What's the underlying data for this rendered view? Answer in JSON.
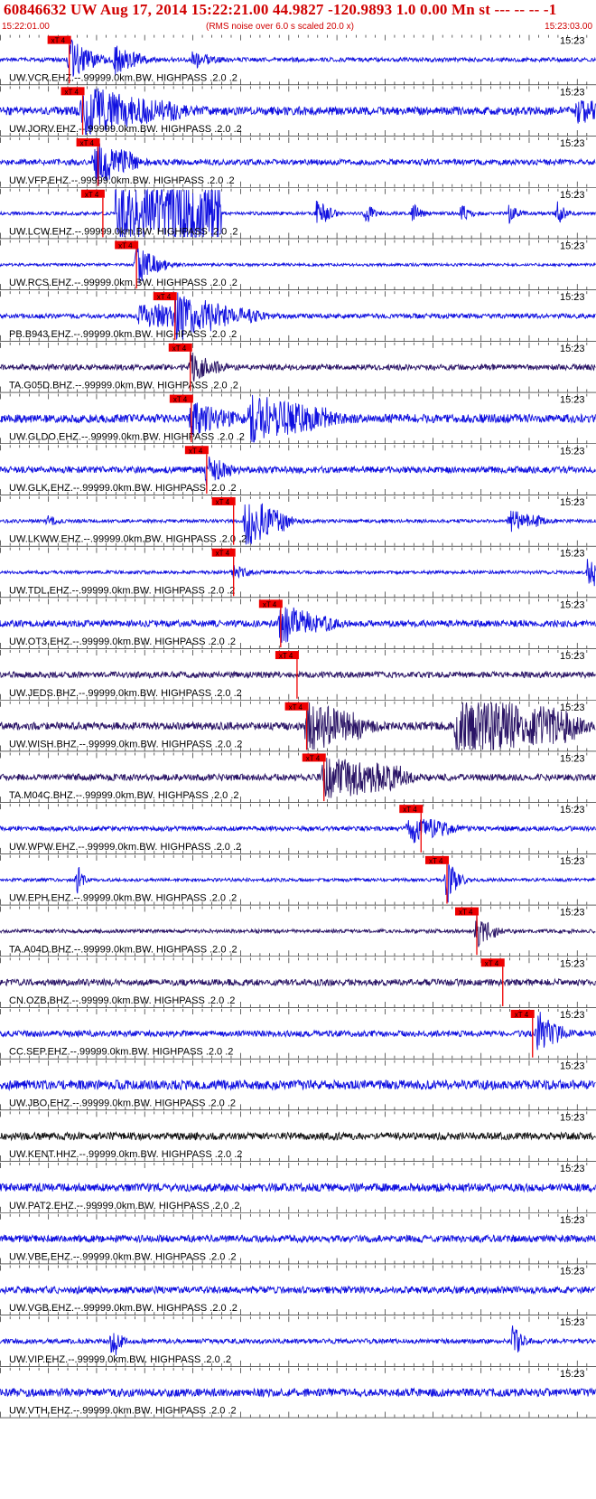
{
  "header": {
    "title": "60846632 UW Aug 17, 2014 15:22:21.00   44.9827 -120.9893  1.0 0.00 Mn st --- -- --  -1",
    "start_time": "15:22:01.00",
    "subtitle": "(RMS noise over 6.0 s scaled 20.0 x)",
    "end_time": "15:23:03.00",
    "tick_time_label": "15:23"
  },
  "colors": {
    "accent": "#d00000",
    "pick_box": "#ee0000",
    "trace_blue": "#1010e0",
    "trace_navy": "#2a1466",
    "trace_black": "#111111",
    "grid": "#000000"
  },
  "chart_data": {
    "type": "seismogram",
    "time_start": "15:22:01.00",
    "time_end": "15:23:03.00",
    "pick_label": "xT 4",
    "filter": "HIGHPASS",
    "traces": [
      {
        "label": "UW.VCR.EHZ.--.99999.0km.BW. HIGHPASS .2.0 .2",
        "pick_s": 7.2,
        "color": "blue",
        "noise": 0.09,
        "events": [
          {
            "t": 7.2,
            "amp": 0.9,
            "dur": 3.0,
            "decay": 0.5
          },
          {
            "t": 12,
            "amp": 0.6,
            "dur": 3,
            "decay": 0.5
          },
          {
            "t": 20,
            "amp": 0.4,
            "dur": 2,
            "decay": 0.4
          }
        ]
      },
      {
        "label": "UW.JORV.EHZ.--.99999.0km.BW. HIGHPASS .2.0 .2",
        "pick_s": 8.6,
        "color": "blue",
        "noise": 0.18,
        "events": [
          {
            "t": 8.6,
            "amp": 1.0,
            "dur": 10,
            "decay": 0.5
          },
          {
            "t": 60,
            "amp": 0.4,
            "dur": 4,
            "decay": 0.3
          }
        ]
      },
      {
        "label": "UW.VFP.EHZ.--.99999.0km.BW. HIGHPASS .2.0 .2",
        "pick_s": 10.2,
        "color": "blue",
        "noise": 0.12,
        "events": [
          {
            "t": 9.8,
            "amp": 1.0,
            "dur": 4,
            "decay": 0.4
          }
        ]
      },
      {
        "label": "UW.LCW.EHZ.--.99999.0km.BW. HIGHPASS .2.0 .2",
        "pick_s": 10.7,
        "color": "blue",
        "noise": 0.07,
        "events": [
          {
            "t": 12,
            "amp": 1.2,
            "dur": 11,
            "decay": 0.0,
            "shape": "box"
          },
          {
            "t": 33,
            "amp": 0.8,
            "dur": 1.5,
            "decay": 0.5
          },
          {
            "t": 38,
            "amp": 0.5,
            "dur": 1,
            "decay": 0.5
          },
          {
            "t": 43,
            "amp": 0.4,
            "dur": 1,
            "decay": 0.5
          },
          {
            "t": 48,
            "amp": 0.4,
            "dur": 1,
            "decay": 0.5
          },
          {
            "t": 53,
            "amp": 0.4,
            "dur": 1,
            "decay": 0.5
          },
          {
            "t": 58,
            "amp": 0.5,
            "dur": 1,
            "decay": 0.5
          }
        ]
      },
      {
        "label": "UW.RCS.EHZ.--.99999.0km.BW. HIGHPASS .2.0 .2",
        "pick_s": 14.2,
        "color": "blue",
        "noise": 0.06,
        "events": [
          {
            "t": 14.2,
            "amp": 0.9,
            "dur": 3,
            "decay": 0.5
          }
        ]
      },
      {
        "label": "PB.B943.EHZ.--.99999.0km.BW. HIGHPASS .2.0 .2",
        "pick_s": 18.2,
        "color": "blue",
        "noise": 0.1,
        "events": [
          {
            "t": 14.5,
            "amp": 0.5,
            "dur": 12,
            "decay": 0.3
          },
          {
            "t": 18.2,
            "amp": 0.8,
            "dur": 5,
            "decay": 0.5
          }
        ]
      },
      {
        "label": "TA.G05D.BHZ.--.99999.0km.BW. HIGHPASS .2.0 .2",
        "pick_s": 19.8,
        "color": "navy",
        "noise": 0.12,
        "events": [
          {
            "t": 19.8,
            "amp": 0.6,
            "dur": 3,
            "decay": 0.5
          }
        ]
      },
      {
        "label": "UW.GLDO.EHZ.--.99999.0km.BW. HIGHPASS .2.0 .2",
        "pick_s": 19.9,
        "color": "blue",
        "noise": 0.18,
        "events": [
          {
            "t": 19.9,
            "amp": 0.6,
            "dur": 4,
            "decay": 0.4
          },
          {
            "t": 26,
            "amp": 1.0,
            "dur": 8,
            "decay": 0.4
          }
        ]
      },
      {
        "label": "UW.GLK.EHZ.--.99999.0km.BW. HIGHPASS .2.0 .2",
        "pick_s": 21.5,
        "color": "blue",
        "noise": 0.14,
        "events": [
          {
            "t": 21.5,
            "amp": 0.6,
            "dur": 2.5,
            "decay": 0.5
          }
        ]
      },
      {
        "label": "UW.LKWW.EHZ.--.99999.0km.BW. HIGHPASS .2.0 .2",
        "pick_s": 24.3,
        "color": "blue",
        "noise": 0.07,
        "events": [
          {
            "t": 25.5,
            "amp": 1.1,
            "dur": 4,
            "decay": 0.35
          },
          {
            "t": 5,
            "amp": 0.25,
            "dur": 1,
            "decay": 0.5
          },
          {
            "t": 53,
            "amp": 0.45,
            "dur": 3,
            "decay": 0.3
          }
        ]
      },
      {
        "label": "UW.TDL.EHZ.--.99999.0km.BW. HIGHPASS .2.0 .2",
        "pick_s": 24.3,
        "color": "blue",
        "noise": 0.07,
        "events": [
          {
            "t": 24.3,
            "amp": 0.3,
            "dur": 2,
            "decay": 0.5
          },
          {
            "t": 61.2,
            "amp": 1.0,
            "dur": 1.5,
            "decay": 0.5
          }
        ]
      },
      {
        "label": "UW.OT3.EHZ.--.99999.0km.BW. HIGHPASS .2.0 .2",
        "pick_s": 29.2,
        "color": "blue",
        "noise": 0.14,
        "events": [
          {
            "t": 29.2,
            "amp": 0.8,
            "dur": 5,
            "decay": 0.45
          }
        ]
      },
      {
        "label": "UW.JEDS.BHZ.--.99999.0km.BW. HIGHPASS .2.0 .2",
        "pick_s": 30.9,
        "color": "navy",
        "noise": 0.13,
        "events": []
      },
      {
        "label": "UW.WISH.BHZ.--.99999.0km.BW. HIGHPASS .2.0 .2",
        "pick_s": 31.9,
        "color": "navy",
        "noise": 0.16,
        "events": [
          {
            "t": 31.9,
            "amp": 1.1,
            "dur": 6,
            "decay": 0.35
          },
          {
            "t": 47.5,
            "amp": 1.2,
            "dur": 12,
            "decay": 0.25
          }
        ]
      },
      {
        "label": "TA.M04C.BHZ.--.99999.0km.BW. HIGHPASS .2.0 .2",
        "pick_s": 33.7,
        "color": "navy",
        "noise": 0.14,
        "events": [
          {
            "t": 33.7,
            "amp": 0.9,
            "dur": 8,
            "decay": 0.3
          }
        ]
      },
      {
        "label": "UW.WPW.EHZ.--.99999.0km.BW. HIGHPASS .2.0 .2",
        "pick_s": 43.8,
        "color": "blue",
        "noise": 0.1,
        "events": [
          {
            "t": 42.5,
            "amp": 0.6,
            "dur": 4,
            "decay": 0.35
          }
        ]
      },
      {
        "label": "UW.EPH.EHZ.--.99999.0km.BW. HIGHPASS .2.0 .2",
        "pick_s": 46.5,
        "color": "blue",
        "noise": 0.07,
        "events": [
          {
            "t": 46.5,
            "amp": 1.0,
            "dur": 1.5,
            "decay": 0.5
          },
          {
            "t": 8,
            "amp": 0.8,
            "dur": 0.8,
            "decay": 0.6
          }
        ]
      },
      {
        "label": "TA.A04D.BHZ.--.99999.0km.BW. HIGHPASS .2.0 .2",
        "pick_s": 49.6,
        "color": "navy",
        "noise": 0.08,
        "events": [
          {
            "t": 49.6,
            "amp": 0.8,
            "dur": 2,
            "decay": 0.5
          }
        ]
      },
      {
        "label": "CN.OZB.BHZ.--.99999.0km.BW. HIGHPASS .2.0 .2",
        "pick_s": 52.3,
        "color": "navy",
        "noise": 0.14,
        "events": []
      },
      {
        "label": "CC.SEP.EHZ.--.99999.0km.BW. HIGHPASS .2.0 .2",
        "pick_s": 55.4,
        "color": "blue",
        "noise": 0.13,
        "events": [
          {
            "t": 56,
            "amp": 0.9,
            "dur": 2.5,
            "decay": 0.5
          }
        ]
      },
      {
        "label": "UW.JBO.EHZ.--.99999.0km.BW. HIGHPASS .2.0 .2",
        "pick_s": null,
        "color": "blue",
        "noise": 0.2,
        "events": []
      },
      {
        "label": "UW.KENT.HHZ.--.99999.0km.BW. HIGHPASS .2.0 .2",
        "pick_s": null,
        "color": "black",
        "noise": 0.16,
        "events": []
      },
      {
        "label": "UW.PAT2.EHZ.--.99999.0km.BW. HIGHPASS .2.0 .2",
        "pick_s": null,
        "color": "blue",
        "noise": 0.17,
        "events": []
      },
      {
        "label": "UW.VBE.EHZ.--.99999.0km.BW. HIGHPASS .2.0 .2",
        "pick_s": null,
        "color": "blue",
        "noise": 0.15,
        "events": []
      },
      {
        "label": "UW.VGB.EHZ.--.99999.0km.BW. HIGHPASS .2.0 .2",
        "pick_s": null,
        "color": "blue",
        "noise": 0.15,
        "events": []
      },
      {
        "label": "UW.VIP.EHZ.--.99999.0km.BW. HIGHPASS .2.0 .2",
        "pick_s": null,
        "color": "blue",
        "noise": 0.1,
        "events": [
          {
            "t": 11.7,
            "amp": 0.9,
            "dur": 1.2,
            "decay": 0.6
          },
          {
            "t": 53.4,
            "amp": 0.8,
            "dur": 1.2,
            "decay": 0.6
          }
        ]
      },
      {
        "label": "UW.VTH.EHZ.--.99999.0km.BW. HIGHPASS .2.0 .2",
        "pick_s": null,
        "color": "blue",
        "noise": 0.17,
        "events": []
      }
    ]
  }
}
